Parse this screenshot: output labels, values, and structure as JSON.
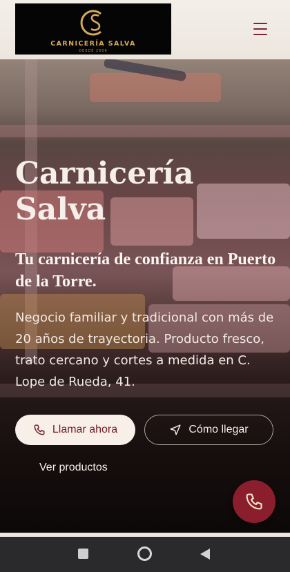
{
  "header": {
    "logo": {
      "monogram": "CS",
      "name": "CARNICERÍA SALVA",
      "tagline": "DESDE 2006"
    },
    "menu_icon": "hamburger-menu-icon"
  },
  "hero": {
    "title": "Carnicería Salva",
    "tagline": "Tu carnicería de confianza en Puerto de la Torre.",
    "description": "Negocio familiar y tradicional con más de 20 años de trayectoria. Producto fresco, trato cercano y cortes a medida en C. Lope de Rueda, 41.",
    "primary_button": {
      "label": "Llamar ahora",
      "icon": "phone-icon"
    },
    "secondary_button": {
      "label": "Cómo llegar",
      "icon": "navigation-arrow-icon"
    },
    "link": {
      "label": "Ver productos"
    }
  },
  "fab": {
    "icon": "phone-icon"
  },
  "system_nav": {
    "recent": "square-icon",
    "home": "circle-icon",
    "back": "triangle-back-icon"
  },
  "colors": {
    "brand": "#7a2633",
    "fab": "#8a1e2c",
    "logo_gold": "#d6a85a",
    "cream": "#f7efe8"
  }
}
